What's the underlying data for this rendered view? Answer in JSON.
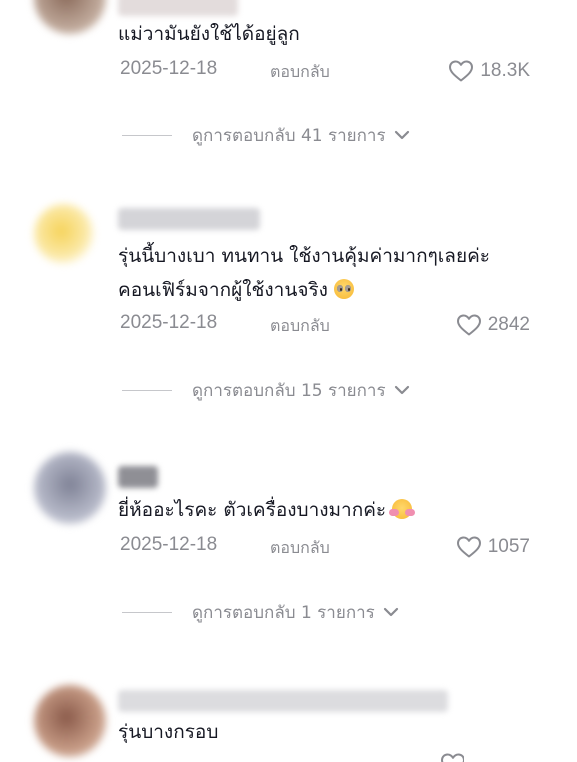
{
  "comments": [
    {
      "text": "แม่วามันยังใช้ได้อยู่ลูก",
      "date": "2025-12-18",
      "reply_label": "ตอบกลับ",
      "likes": "18.3K",
      "view_replies": "ดูการตอบกลับ 41 รายการ"
    },
    {
      "text_line1": "รุ่นนี้บางเบา ทนทาน ใช้งานคุ้มค่ามากๆเลยค่ะ",
      "text_line2": "คอนเฟิร์มจากผู้ใช้งานจริง",
      "emoji": "pleading-face",
      "date": "2025-12-18",
      "reply_label": "ตอบกลับ",
      "likes": "2842",
      "view_replies": "ดูการตอบกลับ 15 รายการ"
    },
    {
      "text": "ยี่ห้ออะไรคะ ตัวเครื่องบางมากค่ะ",
      "emoji": "smiling-face-with-hearts",
      "date": "2025-12-18",
      "reply_label": "ตอบกลับ",
      "likes": "1057",
      "view_replies": "ดูการตอบกลับ 1 รายการ"
    },
    {
      "text": "รุ่นบางกรอบ"
    }
  ],
  "colors": {
    "text_primary": "#161823",
    "text_secondary": "#8a8b91",
    "divider": "#c6c7cb"
  },
  "icons": {
    "like": "heart-outline-icon",
    "expand": "chevron-down-icon"
  }
}
